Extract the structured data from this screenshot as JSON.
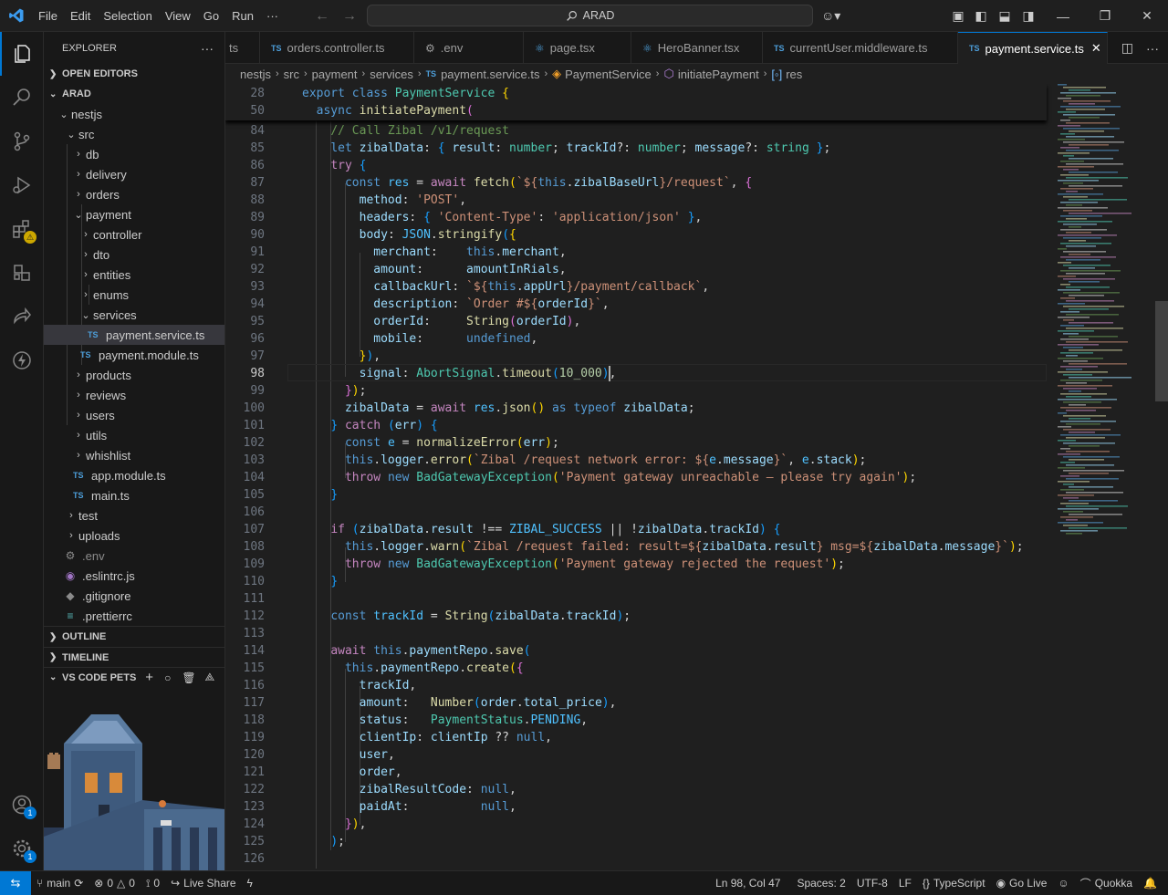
{
  "menu": {
    "file": "File",
    "edit": "Edit",
    "selection": "Selection",
    "view": "View",
    "go": "Go",
    "run": "Run",
    "more": "···"
  },
  "search": {
    "text": "ARAD"
  },
  "explorer": {
    "title": "EXPLORER",
    "sections": {
      "open_editors": "OPEN EDITORS",
      "project": "ARAD",
      "outline": "OUTLINE",
      "timeline": "TIMELINE",
      "pets": "VS CODE PETS"
    },
    "tree": {
      "nestjs": "nestjs",
      "src": "src",
      "db": "db",
      "delivery": "delivery",
      "orders": "orders",
      "payment": "payment",
      "controller": "controller",
      "dto": "dto",
      "entities": "entities",
      "enums": "enums",
      "services": "services",
      "payment_service": "payment.service.ts",
      "payment_module": "payment.module.ts",
      "products": "products",
      "reviews": "reviews",
      "users": "users",
      "utils": "utils",
      "whishlist": "whishlist",
      "app_module": "app.module.ts",
      "main": "main.ts",
      "test": "test",
      "uploads": "uploads",
      "env": ".env",
      "eslintrc": ".eslintrc.js",
      "gitignore": ".gitignore",
      "prettierrc": ".prettierrc"
    },
    "ts_icon": "TS"
  },
  "tabs": [
    {
      "label": "ts"
    },
    {
      "label": "orders.controller.ts"
    },
    {
      "label": ".env"
    },
    {
      "label": "page.tsx"
    },
    {
      "label": "HeroBanner.tsx"
    },
    {
      "label": "currentUser.middleware.ts"
    },
    {
      "label": "payment.service.ts"
    }
  ],
  "breadcrumb": [
    "nestjs",
    "src",
    "payment",
    "services",
    "payment.service.ts",
    "PaymentService",
    "initiatePayment",
    "res"
  ],
  "editor": {
    "sticky_lines": [
      "28",
      "50"
    ],
    "line_numbers": [
      "84",
      "85",
      "86",
      "87",
      "88",
      "89",
      "90",
      "91",
      "92",
      "93",
      "94",
      "95",
      "96",
      "97",
      "98",
      "99",
      "100",
      "101",
      "102",
      "103",
      "104",
      "105",
      "106",
      "107",
      "108",
      "109",
      "110",
      "111",
      "112",
      "113",
      "114",
      "115",
      "116",
      "117",
      "118",
      "119",
      "120",
      "121",
      "122",
      "123",
      "124",
      "125",
      "126"
    ],
    "current_line": "98"
  },
  "status": {
    "branch": "main",
    "errors": "0",
    "warnings": "0",
    "ports": "0",
    "live_share": "Live Share",
    "position": "Ln 98, Col 47",
    "spaces": "Spaces: 2",
    "encoding": "UTF-8",
    "eol": "LF",
    "language": "TypeScript",
    "go_live": "Go Live",
    "quokka": "Quokka"
  },
  "badges": {
    "accounts": "1",
    "settings": "1"
  },
  "colors": {
    "accent": "#0078d4",
    "editor_bg": "#1f1f1f",
    "sidebar_bg": "#181818"
  }
}
